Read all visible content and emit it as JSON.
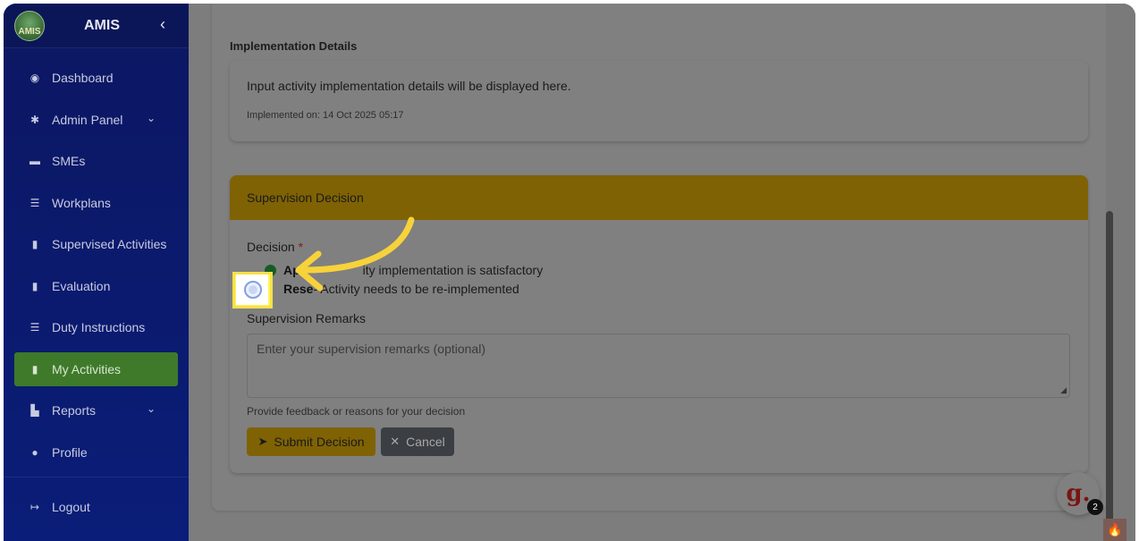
{
  "brand": {
    "logo_text": "AMIS",
    "name": "AMIS",
    "collapse_icon": "chevron-left-icon"
  },
  "sidebar": {
    "items": [
      {
        "label": "Dashboard",
        "icon": "palette-icon"
      },
      {
        "label": "Admin Panel",
        "icon": "gear-icon",
        "has_chevron": true
      },
      {
        "label": "SMEs",
        "icon": "store-icon"
      },
      {
        "label": "Workplans",
        "icon": "list-check-icon"
      },
      {
        "label": "Supervised Activities",
        "icon": "clipboard-icon"
      },
      {
        "label": "Evaluation",
        "icon": "clipboard-check-icon"
      },
      {
        "label": "Duty Instructions",
        "icon": "list-check-icon"
      },
      {
        "label": "My Activities",
        "icon": "clipboard-icon",
        "active": true
      },
      {
        "label": "Reports",
        "icon": "chart-bar-icon",
        "has_chevron": true
      },
      {
        "label": "Profile",
        "icon": "user-icon"
      }
    ],
    "logout": {
      "label": "Logout",
      "icon": "sign-out-icon"
    }
  },
  "implementation": {
    "section_title": "Implementation Details",
    "description": "Input activity implementation details will be displayed here.",
    "implemented_on": "Implemented on: 14 Oct 2025 05:17"
  },
  "supervision": {
    "header": "Supervision Decision",
    "decision_label": "Decision",
    "required_mark": "*",
    "options": [
      {
        "bold": "Approve",
        "visible_bold": "Ap",
        "text": " - Activity implementation is satisfactory",
        "visible_text": "ity implementation is satisfactory"
      },
      {
        "bold": "Reset",
        "visible_bold": "Rese",
        "text": " - Activity needs to be re-implemented",
        "visible_text": " - Activity needs to be re-implemented"
      }
    ],
    "remarks_label": "Supervision Remarks",
    "remarks_placeholder": "Enter your supervision remarks (optional)",
    "help_text": "Provide feedback or reasons for your decision",
    "submit_label": "Submit Decision",
    "cancel_label": "Cancel"
  },
  "widget": {
    "letter": "g.",
    "badge_count": "2"
  },
  "colors": {
    "sidebar_bg": "#0c1762",
    "active_item": "#3e7a2a",
    "header_gold": "#7f6203",
    "highlight_yellow": "#fff45a",
    "arrow_yellow": "#f7d23a"
  }
}
